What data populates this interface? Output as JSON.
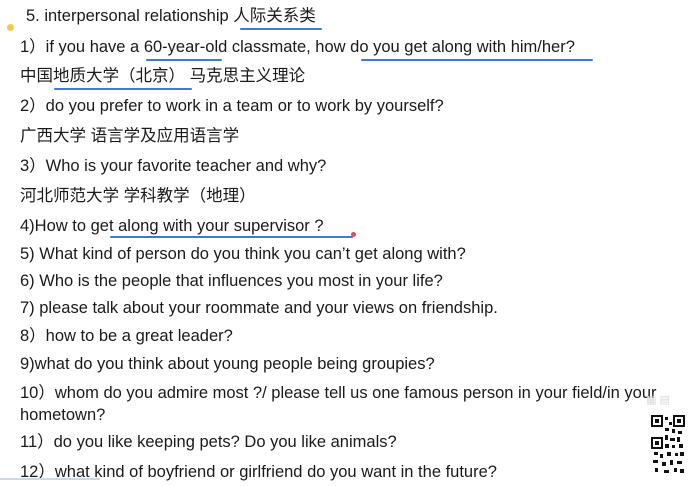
{
  "title": "5. interpersonal relationship 人际关系类",
  "lines": [
    "1）if you have a 60-year-old classmate, how do you get along with him/her?",
    "中国地质大学（北京）  马克思主义理论",
    "2）do you prefer to work in a team or to work by yourself?",
    "广西大学  语言学及应用语言学",
    "3）Who is your favorite teacher and why?",
    "河北师范大学  学科教学（地理）",
    "4)How to get along with your supervisor ?",
    "5) What kind of person do you think you can’t get along with?",
    "6)  Who is the people that influences you most in your life?",
    "7) please talk about your roommate and your views on friendship.",
    "8）how to be a great leader?",
    "9)what do you think about young people being groupies?",
    "10）whom do you admire most ?/ please tell us one famous person in your field/in your",
    "hometown?",
    "11）do you like keeping pets? Do you like animals?",
    "12）what kind of boyfriend or girlfriend do you want in the future?"
  ],
  "colors": {
    "underline": "#3a7bd5",
    "marker_yellow": "#f2c94c",
    "marker_red": "#e05050"
  }
}
